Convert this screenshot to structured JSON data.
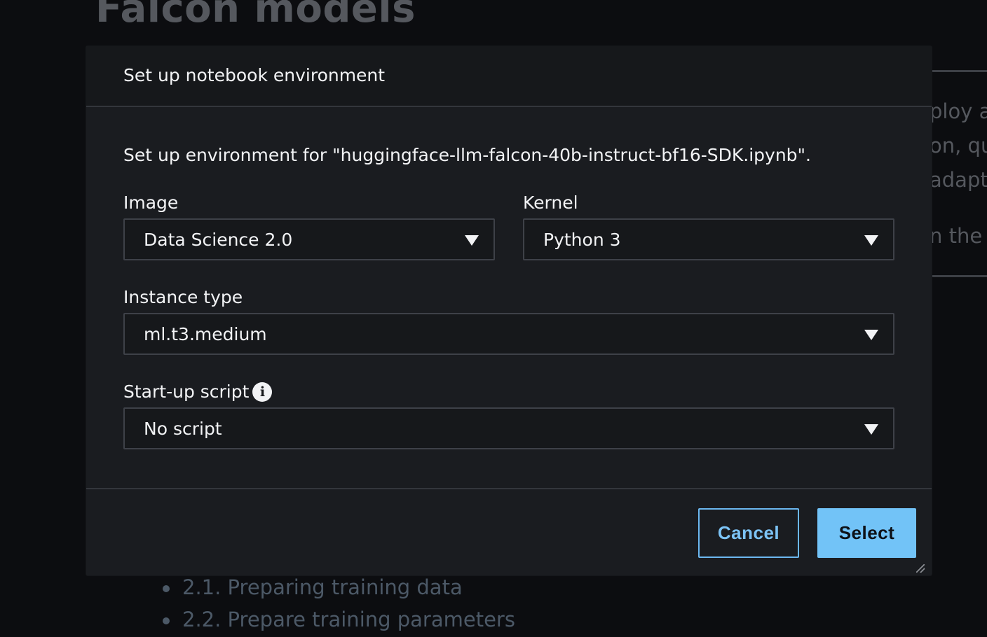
{
  "background": {
    "title": "Falcon models",
    "fragments": [
      "ploy a",
      "on, qu",
      "adapti",
      "n the"
    ],
    "list": [
      "2.1. Preparing training data",
      "2.2. Prepare training parameters"
    ]
  },
  "modal": {
    "title": "Set up notebook environment",
    "description": "Set up environment for \"huggingface-llm-falcon-40b-instruct-bf16-SDK.ipynb\".",
    "image": {
      "label": "Image",
      "value": "Data Science 2.0"
    },
    "kernel": {
      "label": "Kernel",
      "value": "Python 3"
    },
    "instance_type": {
      "label": "Instance type",
      "value": "ml.t3.medium"
    },
    "startup_script": {
      "label": "Start-up script",
      "value": "No script"
    },
    "buttons": {
      "cancel": "Cancel",
      "select": "Select"
    }
  },
  "colors": {
    "accent": "#72c3f7",
    "background": "#0c0d10",
    "modal": "#1a1c20"
  },
  "icons": {
    "info": "info-icon",
    "dropdown": "caret-down-icon",
    "resize": "resize-handle-icon"
  }
}
